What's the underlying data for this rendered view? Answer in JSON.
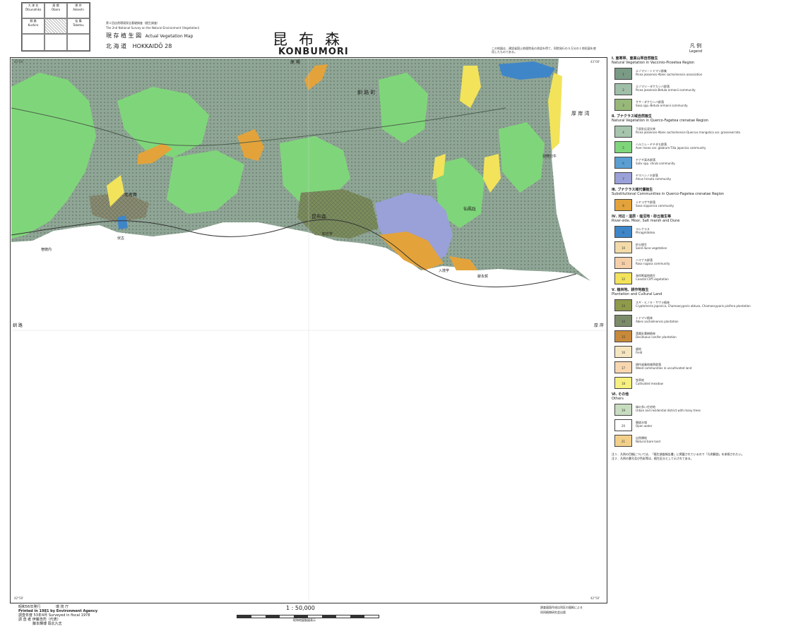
{
  "header": {
    "index_grid": [
      {
        "jp": "大 津 名",
        "en": "Ōtsunahiko"
      },
      {
        "jp": "尾 幌",
        "en": "Oboro"
      },
      {
        "jp": "厚 岸",
        "en": "Akkeshi"
      },
      {
        "jp": "釧 路",
        "en": "Kushiro"
      },
      {
        "jp": "",
        "en": ""
      },
      {
        "jp": "仙 鳳",
        "en": "Tobetsu"
      }
    ],
    "survey_line_jp": "第２回自然環境保全基礎調査（植生調査）",
    "survey_line_en": "The 2nd National Survey on the Natural Environment (Vegetation)",
    "map_type_jp": "現 存 植 生 図",
    "map_type_en": "Actual Vegetation Map",
    "region_jp": "北 海 道",
    "region_code": "HOKKAIDŌ 28",
    "title_jp": "昆布森",
    "title_en": "KONBUMORI",
    "top_note": "この地図は、建設省国土地理院長の承認を得て、同院発行の５万分の１地形図を使用したものである。"
  },
  "map": {
    "place_labels": [
      {
        "text": "尾 幌"
      },
      {
        "text": "釧 路 町"
      },
      {
        "text": "厚 岸 湾"
      },
      {
        "text": "昆布森"
      },
      {
        "text": "老者舞"
      },
      {
        "text": "仙鳳趾"
      },
      {
        "text": "知方学"
      },
      {
        "text": "入境学"
      },
      {
        "text": "釧 路"
      },
      {
        "text": "厚 岸"
      },
      {
        "text": "別寒辺牛"
      },
      {
        "text": "伏古"
      },
      {
        "text": "跡永賀"
      },
      {
        "text": "宿徳内"
      }
    ],
    "corner_coords": {
      "top_left": "43°00'",
      "bottom_left": "42°50'",
      "top_right": "43°00'",
      "bottom_right": "42°50'"
    }
  },
  "legend": {
    "title_jp": "凡 例",
    "title_en": "Legend",
    "sections": [
      {
        "head": "Ⅰ. 亜寒帯、亜高山帯自然植生",
        "sub": "Natural Vegetation in Vaccinio-Piceetea Region",
        "items": [
          {
            "code": "1",
            "jp": "エゾマツ－トドマツ群集",
            "en": "Picea jezoensis-Abies sachalinensis association",
            "color": "#7a9a86"
          },
          {
            "code": "2",
            "jp": "エゾマツ－ダケカンバ群落",
            "en": "Picea jezoensis-Betula ermanii community",
            "color": "#9fbfa8"
          },
          {
            "code": "3",
            "jp": "ササ－ダケカンバ群落",
            "en": "Sasa spp.-Betula ermanii community",
            "color": "#98b87a"
          }
        ]
      },
      {
        "head": "Ⅱ. ブナクラス域自然植生",
        "sub": "Natural Vegetation in Querco-Fagetea crenatae Region",
        "items": [
          {
            "code": "4",
            "jp": "下部針広混交林",
            "en": "Picea jezoensis-Abies sachalinensis-Quercus mongolica var. grosseserrata",
            "color": "#a7c4ad"
          },
          {
            "code": "5",
            "jp": "ハルニレ－ヤチダモ群落",
            "en": "Acer mono var. glabrum-Tilia japonica community",
            "color": "#7fd67a"
          },
          {
            "code": "6",
            "jp": "ヤナギ高木群落",
            "en": "Salix spp. shrub community",
            "color": "#5a9fd4"
          },
          {
            "code": "7",
            "jp": "ヤマハンノキ群落",
            "en": "Alnus hirsuta community",
            "color": "#9aa0d8"
          }
        ]
      },
      {
        "head": "Ⅲ. ブナクラス域代償植生",
        "sub": "Substitutional Communities in Querco-Fagetea crenatae Region",
        "items": [
          {
            "code": "8",
            "jp": "ミヤコザサ群落",
            "en": "Sasa nipponica community",
            "color": "#e3a33a"
          }
        ]
      },
      {
        "head": "Ⅳ. 河辺・湿原・塩沼地・砂丘植生等",
        "sub": "River-side, Moor, Salt marsh and Dune",
        "items": [
          {
            "code": "9",
            "jp": "ヨシクラス",
            "en": "Phragmitetea",
            "color": "#3f86c8"
          },
          {
            "code": "10",
            "jp": "砂丘植生",
            "en": "Sand dune vegetation",
            "color": "#f3dba8"
          },
          {
            "code": "11",
            "jp": "ハマナス群落",
            "en": "Rosa rugosa community",
            "color": "#f5cfa8"
          },
          {
            "code": "12",
            "jp": "海岸断崖地植生",
            "en": "Coastal Cliff vegetation",
            "color": "#f2e35a"
          }
        ]
      },
      {
        "head": "Ⅴ. 植林地、耕作地植生",
        "sub": "Plantation and Cultural Land",
        "items": [
          {
            "code": "13",
            "jp": "スギ・ヒノキ・サワラ植林",
            "en": "Cryptomeria japonica, Chamaecyparis obtusa, Chamaecyparis pisifera plantation",
            "color": "#8f9a4a"
          },
          {
            "code": "14",
            "jp": "トドマツ植林",
            "en": "Abies sachalinensis plantation",
            "color": "#7c8c6a"
          },
          {
            "code": "15",
            "jp": "落葉針葉樹植林",
            "en": "Deciduous conifer plantation",
            "color": "#c88a3a"
          },
          {
            "code": "16",
            "jp": "畑地",
            "en": "Field",
            "color": "#f6e6c0"
          },
          {
            "code": "17",
            "jp": "耕作放棄地雑草群落",
            "en": "Weed communities in uncultivated land",
            "color": "#f7d6b0"
          },
          {
            "code": "18",
            "jp": "牧草地",
            "en": "Cultivated meadow",
            "color": "#f6f080"
          }
        ]
      },
      {
        "head": "Ⅵ. その他",
        "sub": "Others",
        "items": [
          {
            "code": "19",
            "jp": "緑の多い住宅地",
            "en": "Urban and residential district with many trees",
            "color": "#c8dcc0"
          },
          {
            "code": "20",
            "jp": "開放水域",
            "en": "Open water",
            "color": "#ffffff"
          },
          {
            "code": "21",
            "jp": "自然裸地",
            "en": "Natural bare land",
            "color": "#f3d08a"
          }
        ]
      }
    ],
    "notes": [
      "注１．凡例の目細については、「植生調査報告書」に掲載されているので「凡例解説」を参照されたい。",
      "注２．凡例の番号及び色彩等は、植生区分として示されてある。"
    ]
  },
  "footer": {
    "published_line": "昭和56年発行",
    "agency_jp": "環 境 庁",
    "printed_line": "Printed in 1981 by Environment Agency",
    "survey_line": "調査年度 53年4月 Surveyed in fiscal 1978",
    "surveyor_line": "調 査 者 伊藤浩司（代表）",
    "surveyor2_line": "藤本輝博 岡北九志",
    "scale_text": "1 : 50,000",
    "scale_sub": "昭和地図製図表示",
    "right_note_1": "調査図面作成は同区の図紙による",
    "right_note_2": "同同植物研究会出版"
  }
}
